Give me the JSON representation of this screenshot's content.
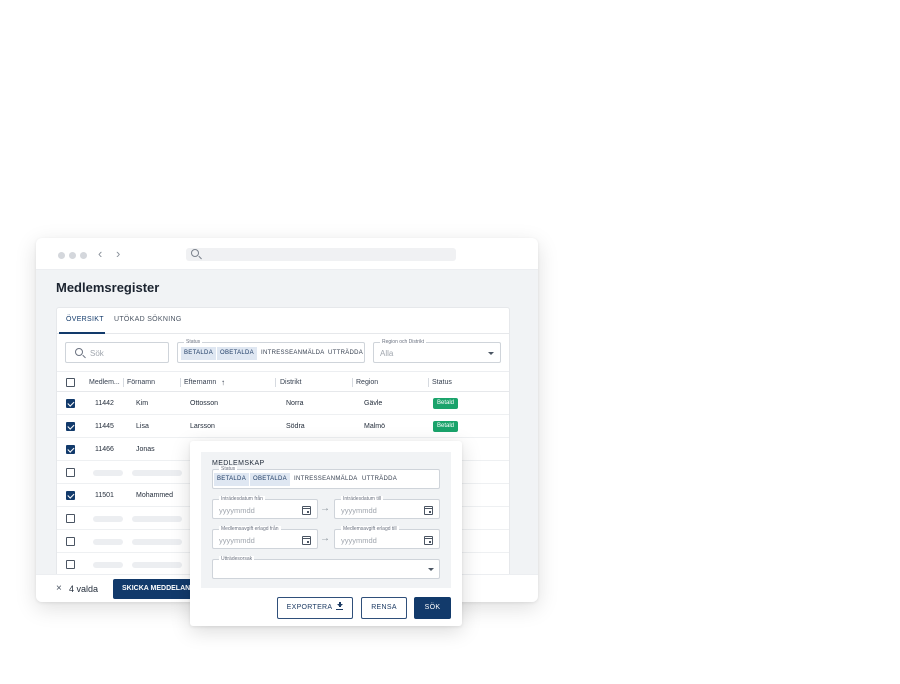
{
  "page": {
    "title": "Medlemsregister",
    "tabs": [
      {
        "label": "ÖVERSIKT",
        "active": true
      },
      {
        "label": "UTÖKAD SÖKNING",
        "active": false
      }
    ],
    "search": {
      "placeholder": "Sök"
    },
    "status_filter": {
      "legend": "Status",
      "chips": [
        {
          "label": "BETALDA",
          "selected": true
        },
        {
          "label": "OBETALDA",
          "selected": true
        },
        {
          "label": "INTRESSEANMÄLDA",
          "selected": false
        },
        {
          "label": "UTTRÄDDA",
          "selected": false
        }
      ]
    },
    "region_filter": {
      "legend": "Region och Distrikt",
      "value": "Alla"
    }
  },
  "table": {
    "columns": [
      "Medlem...",
      "Förnamn",
      "Efternamn",
      "Distrikt",
      "Region",
      "Status"
    ],
    "sort_icon": "arrow-up-icon",
    "rows": [
      {
        "checked": true,
        "id": "11442",
        "first": "Kim",
        "last": "Ottosson",
        "district": "Norra",
        "region": "Gävle",
        "status": "Betald"
      },
      {
        "checked": true,
        "id": "11445",
        "first": "Lisa",
        "last": "Larsson",
        "district": "Södra",
        "region": "Malmö",
        "status": "Betald"
      },
      {
        "checked": true,
        "id": "11466",
        "first": "Jonas",
        "last": "",
        "district": "",
        "region": "",
        "status": ""
      },
      {
        "checked": false,
        "id": "",
        "first": "",
        "last": "",
        "district": "",
        "region": "",
        "status": "",
        "placeholder": true
      },
      {
        "checked": true,
        "id": "11501",
        "first": "Mohammed",
        "last": "",
        "district": "",
        "region": "",
        "status": ""
      },
      {
        "checked": false,
        "id": "",
        "first": "",
        "last": "",
        "district": "",
        "region": "",
        "status": "",
        "placeholder": true
      },
      {
        "checked": false,
        "id": "",
        "first": "",
        "last": "",
        "district": "",
        "region": "",
        "status": "",
        "placeholder": true
      },
      {
        "checked": false,
        "id": "",
        "first": "",
        "last": "",
        "district": "",
        "region": "",
        "status": "",
        "placeholder": true
      }
    ]
  },
  "bulk_bar": {
    "close_icon": "close-icon",
    "count_label": "4 valda",
    "send_button": "SKICKA MEDDELANDE"
  },
  "advanced": {
    "title": "MEDLEMSKAP",
    "status_legend": "Status",
    "status_chips": [
      {
        "label": "BETALDA",
        "selected": true
      },
      {
        "label": "OBETALDA",
        "selected": true
      },
      {
        "label": "INTRESSEANMÄLDA",
        "selected": false
      },
      {
        "label": "UTTRÄDDA",
        "selected": false
      }
    ],
    "join_from": {
      "legend": "Inträdesdatum från",
      "placeholder": "yyyymmdd"
    },
    "join_to": {
      "legend": "Inträdesdatum till",
      "placeholder": "yyyymmdd"
    },
    "fee_from": {
      "legend": "Medlemsavgift erlagd från",
      "placeholder": "yyyymmdd"
    },
    "fee_to": {
      "legend": "Medlemsavgift erlagd till",
      "placeholder": "yyyymmdd"
    },
    "exit_reason": {
      "legend": "Utträdesorsak",
      "value": ""
    },
    "buttons": {
      "export": "EXPORTERA",
      "clear": "RENSA",
      "search": "SÖK"
    }
  },
  "colors": {
    "primary": "#123a6b",
    "paid": "#1aa36b",
    "chip_selected": "#dfe7f2"
  }
}
